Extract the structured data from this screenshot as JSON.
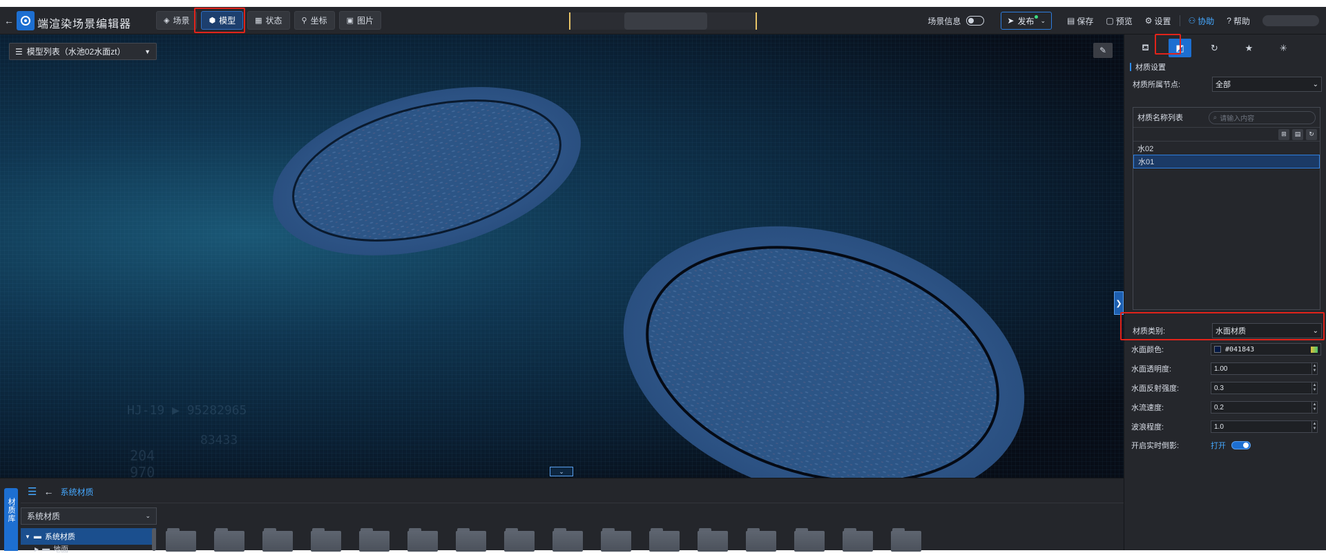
{
  "app": {
    "title": "端渲染场景编辑器"
  },
  "top_tabs": [
    {
      "label": "场景",
      "icon": "layers-icon"
    },
    {
      "label": "模型",
      "icon": "cube-icon"
    },
    {
      "label": "状态",
      "icon": "grid-icon"
    },
    {
      "label": "坐标",
      "icon": "coordinate-icon"
    },
    {
      "label": "图片",
      "icon": "image-icon"
    }
  ],
  "toolbar": {
    "scene_info": "场景信息",
    "publish": "发布",
    "save": "保存",
    "preview": "预览",
    "settings": "设置",
    "collab": "协助",
    "help": "帮助"
  },
  "viewport": {
    "model_list": "模型列表（水池02水面zt）",
    "bg_text_1": "HJ-19  ▶  95282965",
    "bg_text_2": "83433",
    "bg_text_3": "204",
    "bg_text_4": "970"
  },
  "bottom": {
    "lib_tab": "材质库",
    "breadcrumb": "系统材质",
    "select_value": "系统材质",
    "tree_root": "系统材质",
    "tree_child": "地面",
    "folder_count": 16
  },
  "right_panel": {
    "section_title": "材质设置",
    "node_label": "材质所属节点:",
    "node_value": "全部",
    "list_label": "材质名称列表",
    "search_placeholder": "请输入内容",
    "materials": [
      "水02",
      "水01"
    ],
    "type_label": "材质类别:",
    "type_value": "水面材质",
    "water_color_label": "水面颜色:",
    "water_color_value": "#041843",
    "opacity_label": "水面透明度:",
    "opacity_value": "1.00",
    "reflect_label": "水面反射强度:",
    "reflect_value": "0.3",
    "flow_label": "水流速度:",
    "flow_value": "0.2",
    "wave_label": "波浪程度:",
    "wave_value": "1.0",
    "realtime_label": "开启实时倒影:",
    "realtime_value": "打开"
  },
  "colors": {
    "accent": "#1d6fd1",
    "highlight": "#e2231a",
    "water": "#2c5586"
  }
}
